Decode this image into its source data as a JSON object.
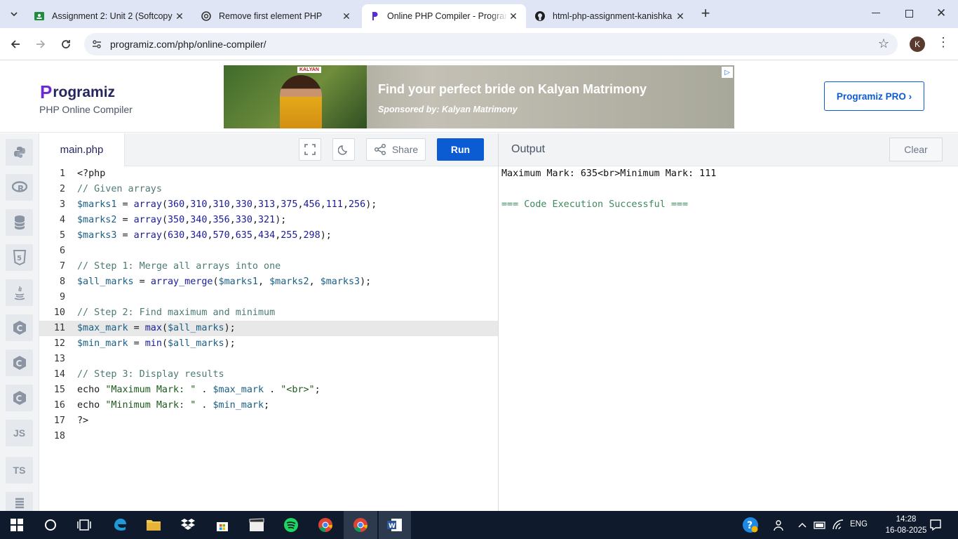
{
  "browser": {
    "tabs": [
      {
        "title": "Assignment 2: Unit 2 (Softcopy",
        "icon": "classroom-icon"
      },
      {
        "title": "Remove first element PHP",
        "icon": "openai-icon"
      },
      {
        "title": "Online PHP Compiler - Programiz",
        "icon": "programiz-icon"
      },
      {
        "title": "html-php-assignment-kanishka",
        "icon": "github-icon"
      }
    ],
    "new_tab": "+",
    "url": "programiz.com/php/online-compiler/",
    "profile_initial": "K"
  },
  "header": {
    "logo": "rogramiz",
    "logo_p": "P",
    "subtitle": "PHP Online Compiler",
    "ad": {
      "brand": "KALYAN",
      "headline": "Find your perfect bride on Kalyan Matrimony",
      "sponsor": "Sponsored by: Kalyan Matrimony"
    },
    "pro_button": "Programiz PRO ›"
  },
  "rail": [
    "python-icon",
    "r-icon",
    "sql-icon",
    "html5-icon",
    "java-icon",
    "c-icon",
    "cpp-icon",
    "csharp-icon",
    "JS",
    "TS",
    "swift-icon"
  ],
  "rail_labels": {
    "js": "JS",
    "ts": "TS"
  },
  "editor": {
    "filename": "main.php",
    "share_label": "Share",
    "run_label": "Run",
    "current_line": 11,
    "lines": [
      "<?php",
      "// Given arrays",
      "$marks1 = array(360,310,310,330,313,375,456,111,256);",
      "$marks2 = array(350,340,356,330,321);",
      "$marks3 = array(630,340,570,635,434,255,298);",
      "",
      "// Step 1: Merge all arrays into one",
      "$all_marks = array_merge($marks1, $marks2, $marks3);",
      "",
      "// Step 2: Find maximum and minimum",
      "$max_mark = max($all_marks);",
      "$min_mark = min($all_marks);",
      "",
      "// Step 3: Display results",
      "echo \"Maximum Mark: \" . $max_mark . \"<br>\";",
      "echo \"Minimum Mark: \" . $min_mark;",
      "?>",
      ""
    ]
  },
  "output": {
    "title": "Output",
    "clear_label": "Clear",
    "lines": [
      "Maximum Mark: 635<br>Minimum Mark: 111",
      "=== Code Execution Successful ==="
    ]
  },
  "taskbar": {
    "time": "14:28",
    "date": "16-08-2025",
    "language": "ENG"
  },
  "colors": {
    "accent": "#0b5bd3",
    "tabbar": "#dfe5f5",
    "taskbar": "#0f1b2d"
  }
}
